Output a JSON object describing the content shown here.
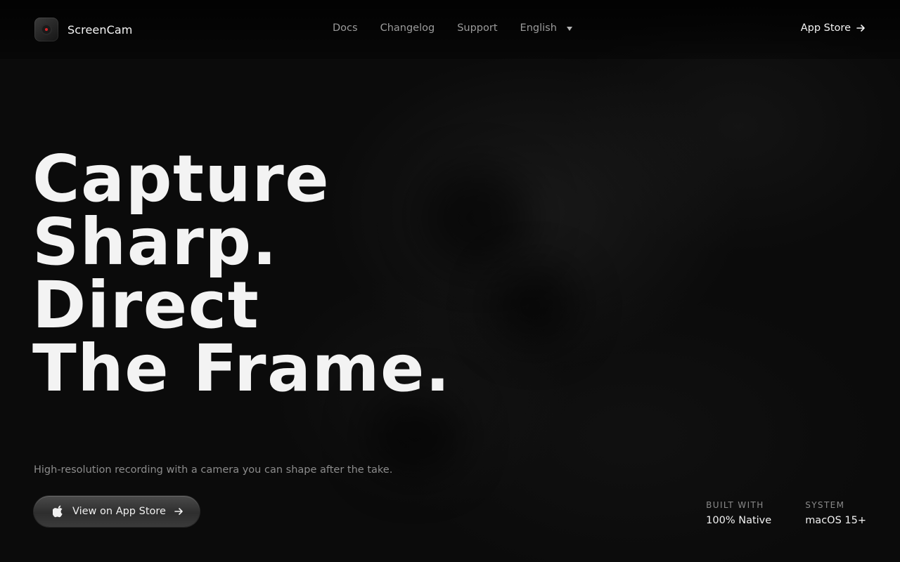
{
  "brand": {
    "name": "ScreenCam",
    "logo_icon": "camera-logo-icon"
  },
  "nav": {
    "links": [
      "Docs",
      "Changelog",
      "Support"
    ],
    "language": "English"
  },
  "header_cta": {
    "label": "App Store",
    "icon": "arrow-right-icon"
  },
  "hero": {
    "headline_lines": [
      "Capture",
      "Sharp.",
      "Direct",
      "The Frame."
    ],
    "subtitle": "High-resolution recording with a camera you can shape after the take.",
    "cta_label": "View on App Store",
    "cta_icons": [
      "apple-icon",
      "arrow-right-icon"
    ]
  },
  "stats": [
    {
      "label": "BUILT WITH",
      "value": "100% Native"
    },
    {
      "label": "SYSTEM",
      "value": "macOS 15+"
    }
  ],
  "colors": {
    "background": "#0b0b0b",
    "text_primary": "#f3f3f3",
    "text_muted": "#9b9b9b",
    "logo_accent": "#d8252a"
  }
}
